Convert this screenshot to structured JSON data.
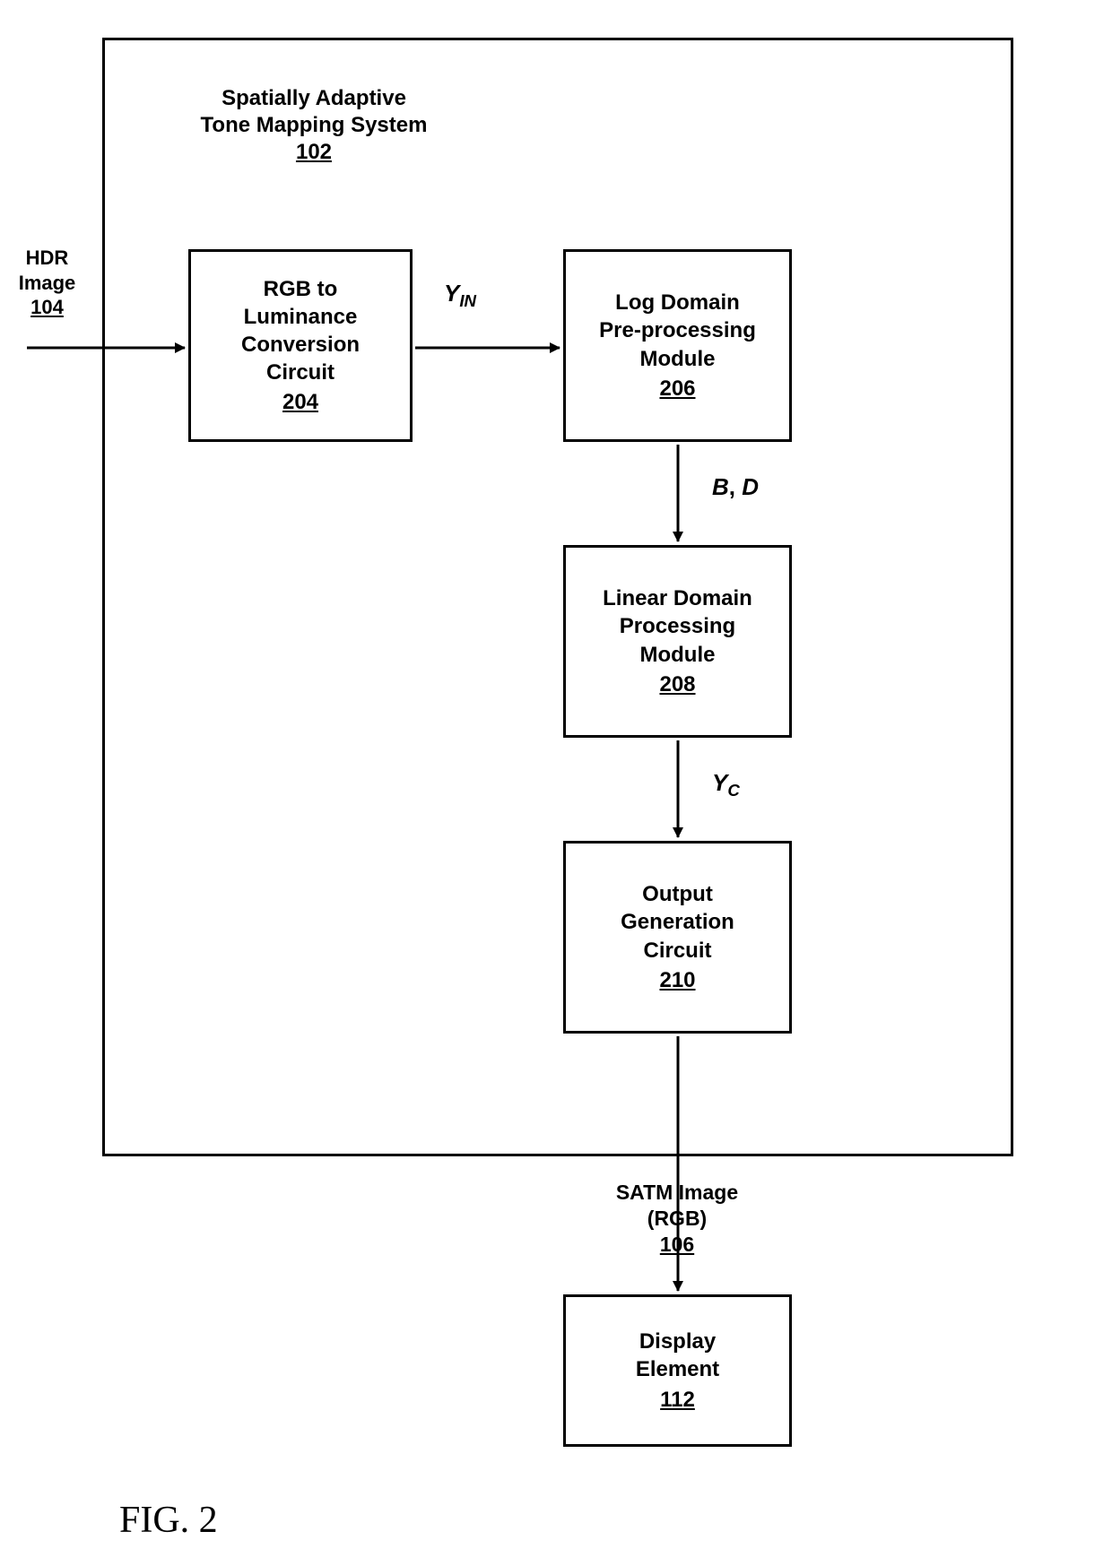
{
  "system": {
    "title_line1": "Spatially Adaptive",
    "title_line2": "Tone Mapping System",
    "ref": "102"
  },
  "input": {
    "line1": "HDR",
    "line2": "Image",
    "ref": "104"
  },
  "blocks": {
    "b204": {
      "line1": "RGB to",
      "line2": "Luminance",
      "line3": "Conversion",
      "line4": "Circuit",
      "ref": "204"
    },
    "b206": {
      "line1": "Log Domain",
      "line2": "Pre-processing",
      "line3": "Module",
      "ref": "206"
    },
    "b208": {
      "line1": "Linear Domain",
      "line2": "Processing",
      "line3": "Module",
      "ref": "208"
    },
    "b210": {
      "line1": "Output",
      "line2": "Generation",
      "line3": "Circuit",
      "ref": "210"
    },
    "b112": {
      "line1": "Display",
      "line2": "Element",
      "ref": "112"
    }
  },
  "output": {
    "line1": "SATM Image",
    "line2": "(RGB)",
    "ref": "106"
  },
  "signals": {
    "yin_base": "Y",
    "yin_sub": "IN",
    "bd_b": "B",
    "bd_sep": ", ",
    "bd_d": "D",
    "yc_base": "Y",
    "yc_sub": "C"
  },
  "figure": "FIG. 2"
}
